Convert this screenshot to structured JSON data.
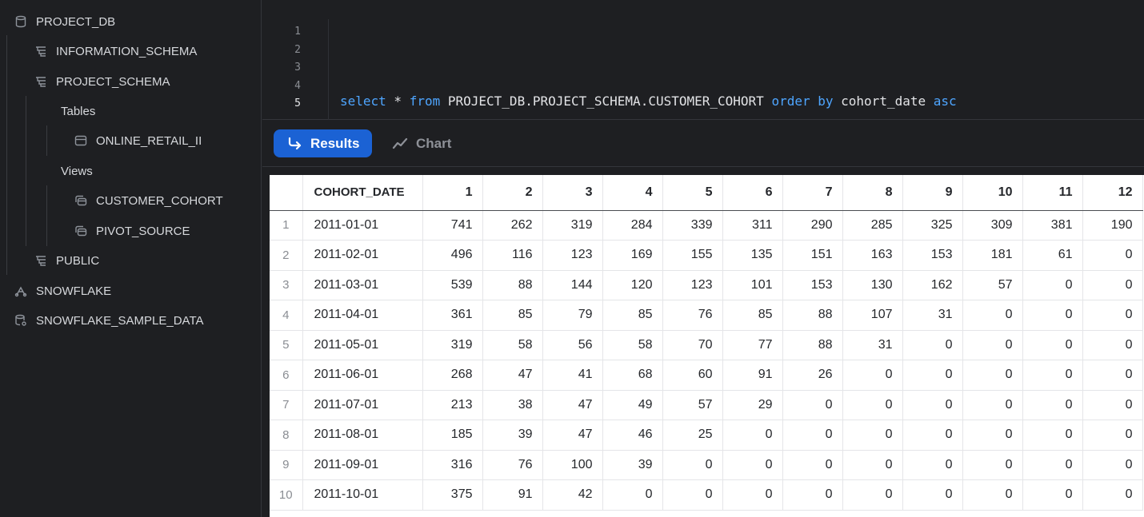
{
  "sidebar": {
    "db": "PROJECT_DB",
    "schema_info": "INFORMATION_SCHEMA",
    "schema_project": "PROJECT_SCHEMA",
    "tables_label": "Tables",
    "table_online": "ONLINE_RETAIL_II",
    "views_label": "Views",
    "view_cohort": "CUSTOMER_COHORT",
    "view_pivot": "PIVOT_SOURCE",
    "schema_public": "PUBLIC",
    "db_snowflake": "SNOWFLAKE",
    "db_sample": "SNOWFLAKE_SAMPLE_DATA"
  },
  "editor": {
    "line_numbers": [
      "1",
      "2",
      "3",
      "4",
      "5"
    ],
    "code": {
      "t1": "select",
      "t2": " * ",
      "t3": "from",
      "t4": " PROJECT_DB.PROJECT_SCHEMA.CUSTOMER_COHORT ",
      "t5": "order by",
      "t6": " cohort_date ",
      "t7": "asc"
    }
  },
  "results_bar": {
    "results_label": "Results",
    "chart_label": "Chart"
  },
  "table": {
    "columns": [
      "COHORT_DATE",
      "1",
      "2",
      "3",
      "4",
      "5",
      "6",
      "7",
      "8",
      "9",
      "10",
      "11",
      "12"
    ],
    "rows": [
      {
        "n": "1",
        "cells": [
          "2011-01-01",
          "741",
          "262",
          "319",
          "284",
          "339",
          "311",
          "290",
          "285",
          "325",
          "309",
          "381",
          "190"
        ]
      },
      {
        "n": "2",
        "cells": [
          "2011-02-01",
          "496",
          "116",
          "123",
          "169",
          "155",
          "135",
          "151",
          "163",
          "153",
          "181",
          "61",
          "0"
        ]
      },
      {
        "n": "3",
        "cells": [
          "2011-03-01",
          "539",
          "88",
          "144",
          "120",
          "123",
          "101",
          "153",
          "130",
          "162",
          "57",
          "0",
          "0"
        ]
      },
      {
        "n": "4",
        "cells": [
          "2011-04-01",
          "361",
          "85",
          "79",
          "85",
          "76",
          "85",
          "88",
          "107",
          "31",
          "0",
          "0",
          "0"
        ]
      },
      {
        "n": "5",
        "cells": [
          "2011-05-01",
          "319",
          "58",
          "56",
          "58",
          "70",
          "77",
          "88",
          "31",
          "0",
          "0",
          "0",
          "0"
        ]
      },
      {
        "n": "6",
        "cells": [
          "2011-06-01",
          "268",
          "47",
          "41",
          "68",
          "60",
          "91",
          "26",
          "0",
          "0",
          "0",
          "0",
          "0"
        ]
      },
      {
        "n": "7",
        "cells": [
          "2011-07-01",
          "213",
          "38",
          "47",
          "49",
          "57",
          "29",
          "0",
          "0",
          "0",
          "0",
          "0",
          "0"
        ]
      },
      {
        "n": "8",
        "cells": [
          "2011-08-01",
          "185",
          "39",
          "47",
          "46",
          "25",
          "0",
          "0",
          "0",
          "0",
          "0",
          "0",
          "0"
        ]
      },
      {
        "n": "9",
        "cells": [
          "2011-09-01",
          "316",
          "76",
          "100",
          "39",
          "0",
          "0",
          "0",
          "0",
          "0",
          "0",
          "0",
          "0"
        ]
      },
      {
        "n": "10",
        "cells": [
          "2011-10-01",
          "375",
          "91",
          "42",
          "0",
          "0",
          "0",
          "0",
          "0",
          "0",
          "0",
          "0",
          "0"
        ]
      }
    ]
  },
  "colors": {
    "accent": "#1b62d4",
    "keyword": "#4ea5ff",
    "background": "#1e1f22"
  }
}
